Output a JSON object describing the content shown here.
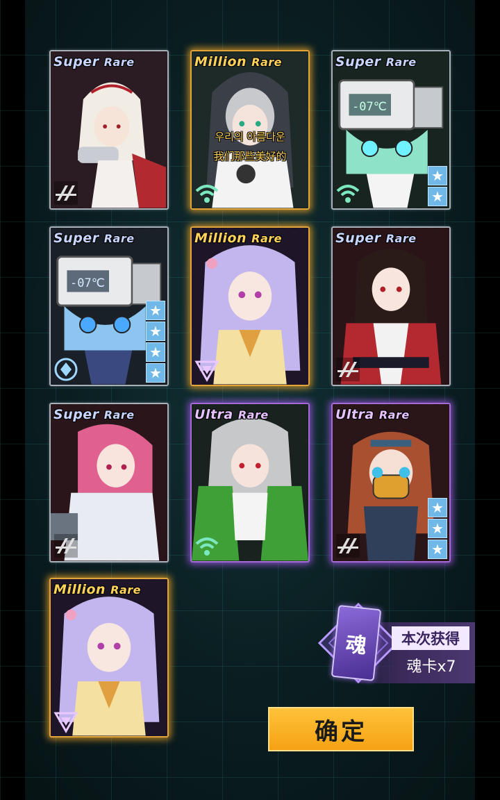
{
  "cards": [
    {
      "rarity_main": "Super",
      "rarity_sub": "Rare",
      "tier": "sr",
      "faction": "stripes",
      "stars": 0
    },
    {
      "rarity_main": "Million",
      "rarity_sub": "Rare",
      "tier": "mr",
      "faction": "wifi",
      "stars": 0,
      "overlay_line1": "우리의 아름다운",
      "overlay_line2": "我们那些美好的"
    },
    {
      "rarity_main": "Super",
      "rarity_sub": "Rare",
      "tier": "sr",
      "faction": "wifi",
      "stars": 2,
      "screen_text": "-07℃"
    },
    {
      "rarity_main": "Super",
      "rarity_sub": "Rare",
      "tier": "sr",
      "faction": "circle",
      "stars": 4,
      "screen_text": "-07℃"
    },
    {
      "rarity_main": "Million",
      "rarity_sub": "Rare",
      "tier": "mr",
      "faction": "triangle",
      "stars": 0
    },
    {
      "rarity_main": "Super",
      "rarity_sub": "Rare",
      "tier": "sr",
      "faction": "stripes",
      "stars": 0
    },
    {
      "rarity_main": "Super",
      "rarity_sub": "Rare",
      "tier": "sr",
      "faction": "stripes",
      "stars": 0
    },
    {
      "rarity_main": "Ultra",
      "rarity_sub": "Rare",
      "tier": "ur",
      "faction": "wifi",
      "stars": 0
    },
    {
      "rarity_main": "Ultra",
      "rarity_sub": "Rare",
      "tier": "ur",
      "faction": "stripes",
      "stars": 3
    },
    {
      "rarity_main": "Million",
      "rarity_sub": "Rare",
      "tier": "mr",
      "faction": "triangle",
      "stars": 0
    }
  ],
  "reward": {
    "icon_char": "魂",
    "title": "本次获得",
    "count": "魂卡x7"
  },
  "confirm_button": "确定",
  "colors": {
    "accent": "#f5a214",
    "sr_border": "#a8b0ba",
    "mr_glow": "#e3a43a",
    "ur_glow": "#a56ad8"
  }
}
